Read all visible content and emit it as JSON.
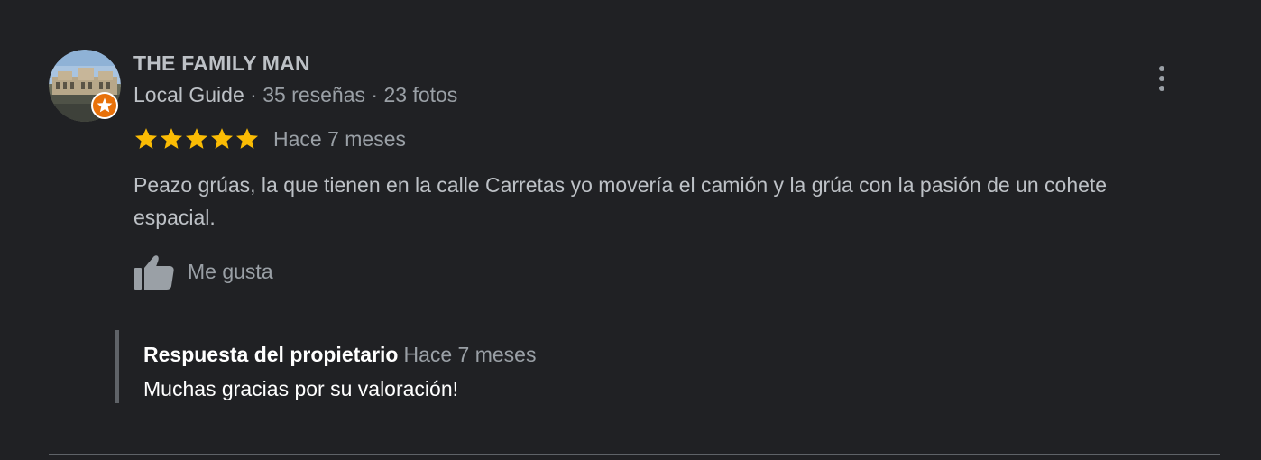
{
  "review": {
    "author": {
      "name": "THE FAMILY MAN",
      "guide_label": "Local Guide",
      "separator_1": " · ",
      "reviews_count": "35 reseñas",
      "separator_2": " · ",
      "photos_count": "23 fotos",
      "avatar_icon": "user-photo",
      "badge_icon": "local-guide-star-badge"
    },
    "rating": {
      "stars": 5,
      "max_stars": 5,
      "star_color": "#fbbc04"
    },
    "date": "Hace 7 meses",
    "text": "Peazo grúas, la que tienen en la calle Carretas yo movería el camión y la grúa con la pasión de un cohete espacial.",
    "like_label": "Me gusta",
    "like_icon": "thumbs-up-icon",
    "more_icon": "more-vert-icon",
    "owner_reply": {
      "title": "Respuesta del propietario",
      "date": "Hace 7 meses",
      "text": "Muchas gracias por su valoración!"
    }
  },
  "colors": {
    "background": "#202124",
    "primary_text": "#bdc1c6",
    "secondary_text": "#9aa0a6",
    "reply_text": "#ffffff",
    "badge_orange": "#e8710a"
  }
}
